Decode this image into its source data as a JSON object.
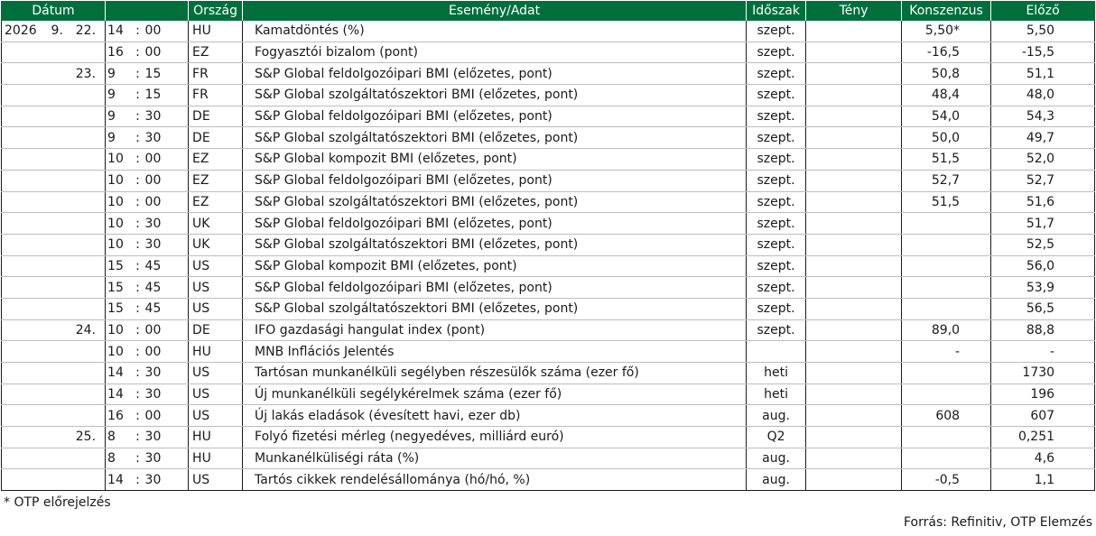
{
  "header": {
    "datum": "Dátum",
    "orszag": "Ország",
    "esemeny": "Esemény/Adat",
    "idoszak": "Időszak",
    "teny": "Tény",
    "konszenzus": "Konszenzus",
    "elozo": "Előző"
  },
  "rows": [
    {
      "year": "2026",
      "month": "9.",
      "day": "22.",
      "hh": "14",
      "sep": ":",
      "mm": "00",
      "country": "HU",
      "event": "Kamatdöntés (%)",
      "period": "szept.",
      "actual": "",
      "consensus": "5,50*",
      "previous": "5,50"
    },
    {
      "year": "",
      "month": "",
      "day": "",
      "hh": "16",
      "sep": ":",
      "mm": "00",
      "country": "EZ",
      "event": "Fogyasztói bizalom (pont)",
      "period": "szept.",
      "actual": "",
      "consensus": "-16,5",
      "previous": "-15,5"
    },
    {
      "year": "",
      "month": "",
      "day": "23.",
      "hh": "9",
      "sep": ":",
      "mm": "15",
      "country": "FR",
      "event": "S&P Global feldolgozóipari BMI (előzetes, pont)",
      "period": "szept.",
      "actual": "",
      "consensus": "50,8",
      "previous": "51,1"
    },
    {
      "year": "",
      "month": "",
      "day": "",
      "hh": "9",
      "sep": ":",
      "mm": "15",
      "country": "FR",
      "event": "S&P Global szolgáltatószektori BMI (előzetes, pont)",
      "period": "szept.",
      "actual": "",
      "consensus": "48,4",
      "previous": "48,0"
    },
    {
      "year": "",
      "month": "",
      "day": "",
      "hh": "9",
      "sep": ":",
      "mm": "30",
      "country": "DE",
      "event": "S&P Global feldolgozóipari BMI (előzetes, pont)",
      "period": "szept.",
      "actual": "",
      "consensus": "54,0",
      "previous": "54,3"
    },
    {
      "year": "",
      "month": "",
      "day": "",
      "hh": "9",
      "sep": ":",
      "mm": "30",
      "country": "DE",
      "event": "S&P Global szolgáltatószektori BMI (előzetes, pont)",
      "period": "szept.",
      "actual": "",
      "consensus": "50,0",
      "previous": "49,7"
    },
    {
      "year": "",
      "month": "",
      "day": "",
      "hh": "10",
      "sep": ":",
      "mm": "00",
      "country": "EZ",
      "event": "S&P Global kompozit BMI (előzetes, pont)",
      "period": "szept.",
      "actual": "",
      "consensus": "51,5",
      "previous": "52,0"
    },
    {
      "year": "",
      "month": "",
      "day": "",
      "hh": "10",
      "sep": ":",
      "mm": "00",
      "country": "EZ",
      "event": "S&P Global feldolgozóipari BMI (előzetes, pont)",
      "period": "szept.",
      "actual": "",
      "consensus": "52,7",
      "previous": "52,7"
    },
    {
      "year": "",
      "month": "",
      "day": "",
      "hh": "10",
      "sep": ":",
      "mm": "00",
      "country": "EZ",
      "event": "S&P Global szolgáltatószektori BMI (előzetes, pont)",
      "period": "szept.",
      "actual": "",
      "consensus": "51,5",
      "previous": "51,6"
    },
    {
      "year": "",
      "month": "",
      "day": "",
      "hh": "10",
      "sep": ":",
      "mm": "30",
      "country": "UK",
      "event": "S&P Global feldolgozóipari BMI (előzetes, pont)",
      "period": "szept.",
      "actual": "",
      "consensus": "",
      "previous": "51,7"
    },
    {
      "year": "",
      "month": "",
      "day": "",
      "hh": "10",
      "sep": ":",
      "mm": "30",
      "country": "UK",
      "event": "S&P Global szolgáltatószektori BMI (előzetes, pont)",
      "period": "szept.",
      "actual": "",
      "consensus": "",
      "previous": "52,5"
    },
    {
      "year": "",
      "month": "",
      "day": "",
      "hh": "15",
      "sep": ":",
      "mm": "45",
      "country": "US",
      "event": "S&P Global kompozit BMI (előzetes, pont)",
      "period": "szept.",
      "actual": "",
      "consensus": "",
      "previous": "56,0"
    },
    {
      "year": "",
      "month": "",
      "day": "",
      "hh": "15",
      "sep": ":",
      "mm": "45",
      "country": "US",
      "event": "S&P Global feldolgozóipari BMI (előzetes, pont)",
      "period": "szept.",
      "actual": "",
      "consensus": "",
      "previous": "53,9"
    },
    {
      "year": "",
      "month": "",
      "day": "",
      "hh": "15",
      "sep": ":",
      "mm": "45",
      "country": "US",
      "event": "S&P Global szolgáltatószektori BMI (előzetes, pont)",
      "period": "szept.",
      "actual": "",
      "consensus": "",
      "previous": "56,5"
    },
    {
      "year": "",
      "month": "",
      "day": "24.",
      "hh": "10",
      "sep": ":",
      "mm": "00",
      "country": "DE",
      "event": "IFO gazdasági hangulat index (pont)",
      "period": "szept.",
      "actual": "",
      "consensus": "89,0",
      "previous": "88,8"
    },
    {
      "year": "",
      "month": "",
      "day": "",
      "hh": "10",
      "sep": ":",
      "mm": "00",
      "country": "HU",
      "event": "MNB Inflációs Jelentés",
      "period": "",
      "actual": "",
      "consensus": "-",
      "previous": "-"
    },
    {
      "year": "",
      "month": "",
      "day": "",
      "hh": "14",
      "sep": ":",
      "mm": "30",
      "country": "US",
      "event": "Tartósan munkanélküli segélyben részesülők száma (ezer fő)",
      "period": "heti",
      "actual": "",
      "consensus": "",
      "previous": "1730"
    },
    {
      "year": "",
      "month": "",
      "day": "",
      "hh": "14",
      "sep": ":",
      "mm": "30",
      "country": "US",
      "event": "Új munkanélküli segélykérelmek száma (ezer fő)",
      "period": "heti",
      "actual": "",
      "consensus": "",
      "previous": "196"
    },
    {
      "year": "",
      "month": "",
      "day": "",
      "hh": "16",
      "sep": ":",
      "mm": "00",
      "country": "US",
      "event": "Új lakás eladások (évesített havi, ezer db)",
      "period": "aug.",
      "actual": "",
      "consensus": "608",
      "previous": "607"
    },
    {
      "year": "",
      "month": "",
      "day": "25.",
      "hh": "8",
      "sep": ":",
      "mm": "30",
      "country": "HU",
      "event": "Folyó fizetési mérleg (negyedéves, milliárd euró)",
      "period": "Q2",
      "actual": "",
      "consensus": "",
      "previous": "0,251"
    },
    {
      "year": "",
      "month": "",
      "day": "",
      "hh": "8",
      "sep": ":",
      "mm": "30",
      "country": "HU",
      "event": "Munkanélküliségi ráta (%)",
      "period": "aug.",
      "actual": "",
      "consensus": "",
      "previous": "4,6"
    },
    {
      "year": "",
      "month": "",
      "day": "",
      "hh": "14",
      "sep": ":",
      "mm": "30",
      "country": "US",
      "event": "Tartós cikkek rendelésállománya (hó/hó, %)",
      "period": "aug.",
      "actual": "",
      "consensus": "-0,5",
      "previous": "1,1"
    }
  ],
  "footnote": "* OTP előrejelzés",
  "source": "Forrás: Refinitiv, OTP Elemzés"
}
